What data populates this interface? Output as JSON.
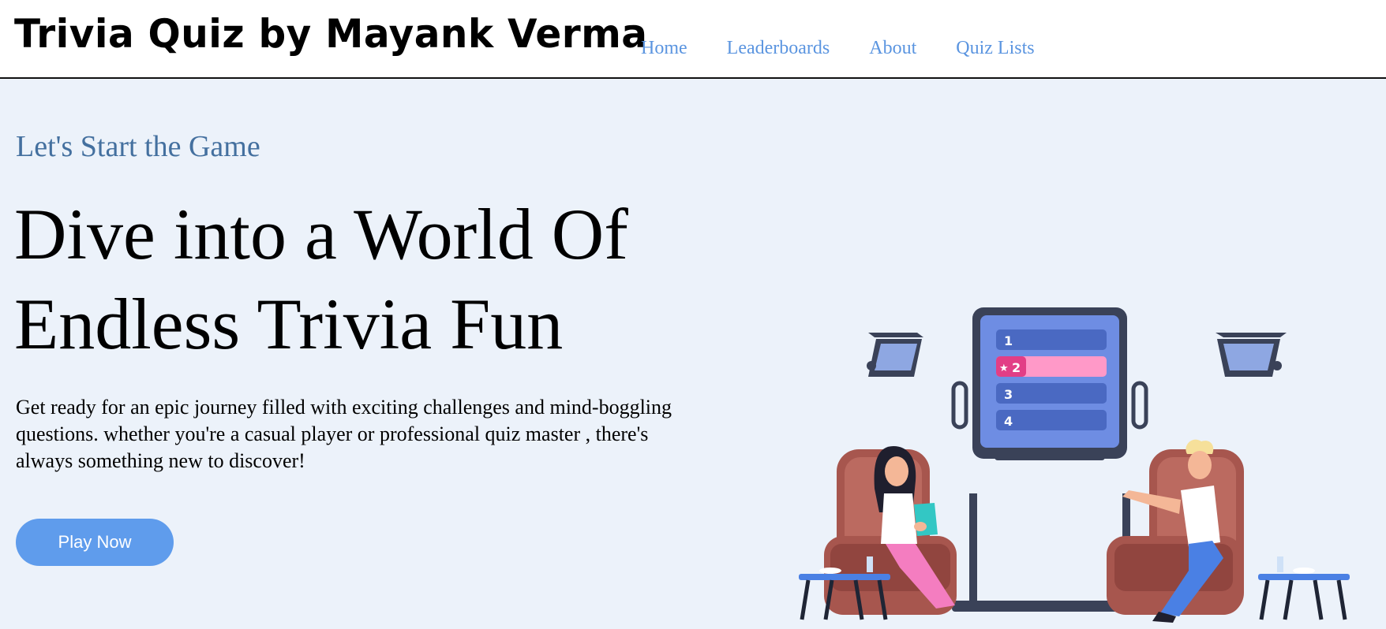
{
  "header": {
    "brand": "Trivia Quiz by Mayank Verma",
    "nav": [
      "Home",
      "Leaderboards",
      "About",
      "Quiz Lists"
    ]
  },
  "hero": {
    "eyebrow": "Let's Start the Game",
    "headline_line1": "Dive into a World Of",
    "headline_line2": "Endless Trivia Fun",
    "description": "Get ready for an epic journey filled with exciting challenges and mind-boggling questions. whether you're a casual player or professional quiz master , there's always something new to discover!",
    "cta_label": "Play Now"
  },
  "illustration": {
    "scoreboard_ranks": [
      "1",
      "2",
      "3",
      "4"
    ],
    "highlighted_rank": "2"
  },
  "colors": {
    "background": "#ecf2fa",
    "nav_link": "#5b95e0",
    "eyebrow": "#44709f",
    "cta": "#5f9cec",
    "highlight_row": "#ff99c8"
  }
}
